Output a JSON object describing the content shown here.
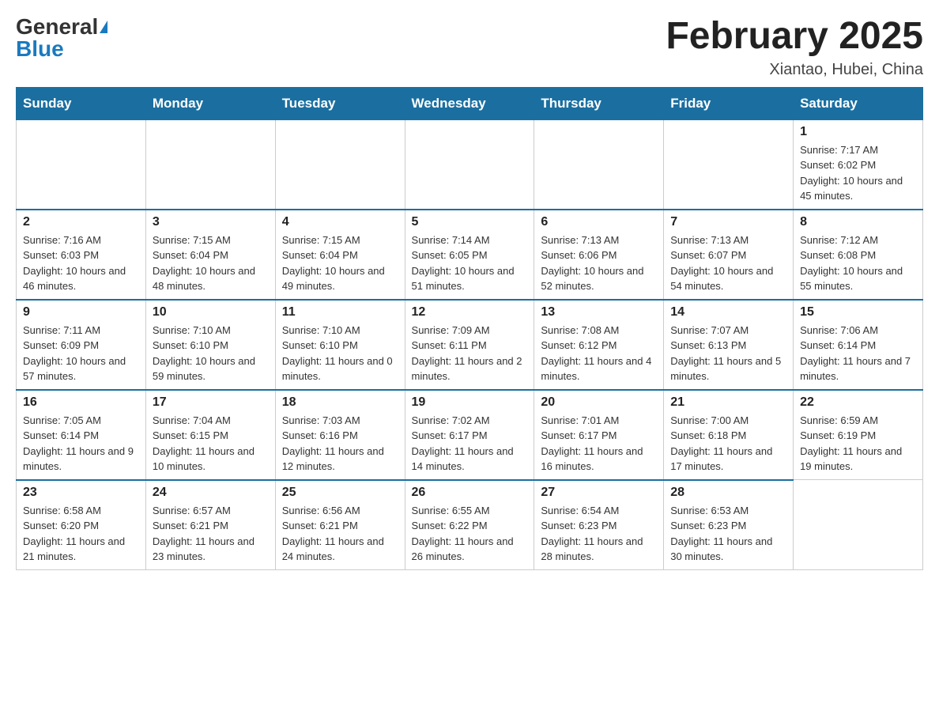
{
  "header": {
    "logo_general": "General",
    "logo_blue": "Blue",
    "month_title": "February 2025",
    "location": "Xiantao, Hubei, China"
  },
  "days_of_week": [
    "Sunday",
    "Monday",
    "Tuesday",
    "Wednesday",
    "Thursday",
    "Friday",
    "Saturday"
  ],
  "weeks": [
    [
      {
        "day": "",
        "info": ""
      },
      {
        "day": "",
        "info": ""
      },
      {
        "day": "",
        "info": ""
      },
      {
        "day": "",
        "info": ""
      },
      {
        "day": "",
        "info": ""
      },
      {
        "day": "",
        "info": ""
      },
      {
        "day": "1",
        "info": "Sunrise: 7:17 AM\nSunset: 6:02 PM\nDaylight: 10 hours and 45 minutes."
      }
    ],
    [
      {
        "day": "2",
        "info": "Sunrise: 7:16 AM\nSunset: 6:03 PM\nDaylight: 10 hours and 46 minutes."
      },
      {
        "day": "3",
        "info": "Sunrise: 7:15 AM\nSunset: 6:04 PM\nDaylight: 10 hours and 48 minutes."
      },
      {
        "day": "4",
        "info": "Sunrise: 7:15 AM\nSunset: 6:04 PM\nDaylight: 10 hours and 49 minutes."
      },
      {
        "day": "5",
        "info": "Sunrise: 7:14 AM\nSunset: 6:05 PM\nDaylight: 10 hours and 51 minutes."
      },
      {
        "day": "6",
        "info": "Sunrise: 7:13 AM\nSunset: 6:06 PM\nDaylight: 10 hours and 52 minutes."
      },
      {
        "day": "7",
        "info": "Sunrise: 7:13 AM\nSunset: 6:07 PM\nDaylight: 10 hours and 54 minutes."
      },
      {
        "day": "8",
        "info": "Sunrise: 7:12 AM\nSunset: 6:08 PM\nDaylight: 10 hours and 55 minutes."
      }
    ],
    [
      {
        "day": "9",
        "info": "Sunrise: 7:11 AM\nSunset: 6:09 PM\nDaylight: 10 hours and 57 minutes."
      },
      {
        "day": "10",
        "info": "Sunrise: 7:10 AM\nSunset: 6:10 PM\nDaylight: 10 hours and 59 minutes."
      },
      {
        "day": "11",
        "info": "Sunrise: 7:10 AM\nSunset: 6:10 PM\nDaylight: 11 hours and 0 minutes."
      },
      {
        "day": "12",
        "info": "Sunrise: 7:09 AM\nSunset: 6:11 PM\nDaylight: 11 hours and 2 minutes."
      },
      {
        "day": "13",
        "info": "Sunrise: 7:08 AM\nSunset: 6:12 PM\nDaylight: 11 hours and 4 minutes."
      },
      {
        "day": "14",
        "info": "Sunrise: 7:07 AM\nSunset: 6:13 PM\nDaylight: 11 hours and 5 minutes."
      },
      {
        "day": "15",
        "info": "Sunrise: 7:06 AM\nSunset: 6:14 PM\nDaylight: 11 hours and 7 minutes."
      }
    ],
    [
      {
        "day": "16",
        "info": "Sunrise: 7:05 AM\nSunset: 6:14 PM\nDaylight: 11 hours and 9 minutes."
      },
      {
        "day": "17",
        "info": "Sunrise: 7:04 AM\nSunset: 6:15 PM\nDaylight: 11 hours and 10 minutes."
      },
      {
        "day": "18",
        "info": "Sunrise: 7:03 AM\nSunset: 6:16 PM\nDaylight: 11 hours and 12 minutes."
      },
      {
        "day": "19",
        "info": "Sunrise: 7:02 AM\nSunset: 6:17 PM\nDaylight: 11 hours and 14 minutes."
      },
      {
        "day": "20",
        "info": "Sunrise: 7:01 AM\nSunset: 6:17 PM\nDaylight: 11 hours and 16 minutes."
      },
      {
        "day": "21",
        "info": "Sunrise: 7:00 AM\nSunset: 6:18 PM\nDaylight: 11 hours and 17 minutes."
      },
      {
        "day": "22",
        "info": "Sunrise: 6:59 AM\nSunset: 6:19 PM\nDaylight: 11 hours and 19 minutes."
      }
    ],
    [
      {
        "day": "23",
        "info": "Sunrise: 6:58 AM\nSunset: 6:20 PM\nDaylight: 11 hours and 21 minutes."
      },
      {
        "day": "24",
        "info": "Sunrise: 6:57 AM\nSunset: 6:21 PM\nDaylight: 11 hours and 23 minutes."
      },
      {
        "day": "25",
        "info": "Sunrise: 6:56 AM\nSunset: 6:21 PM\nDaylight: 11 hours and 24 minutes."
      },
      {
        "day": "26",
        "info": "Sunrise: 6:55 AM\nSunset: 6:22 PM\nDaylight: 11 hours and 26 minutes."
      },
      {
        "day": "27",
        "info": "Sunrise: 6:54 AM\nSunset: 6:23 PM\nDaylight: 11 hours and 28 minutes."
      },
      {
        "day": "28",
        "info": "Sunrise: 6:53 AM\nSunset: 6:23 PM\nDaylight: 11 hours and 30 minutes."
      },
      {
        "day": "",
        "info": ""
      }
    ]
  ]
}
